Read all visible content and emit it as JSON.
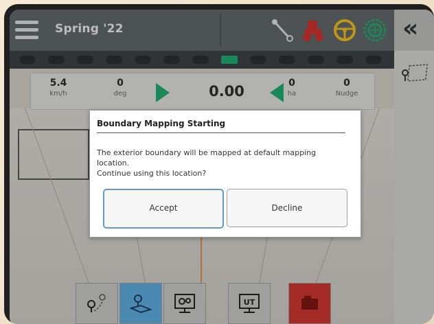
{
  "header": {
    "title": "Spring '22",
    "icons": [
      "menu-icon",
      "implement-hitch-icon",
      "tractor-icon",
      "steering-wheel-icon",
      "gps-status-icon"
    ]
  },
  "lightbar": {
    "segments": 13,
    "active_index": 7,
    "active_color": "#1ea66e"
  },
  "right_panel": {
    "collapse_glyph": "«",
    "icons": [
      "collapse-icon",
      "boundary-map-icon"
    ]
  },
  "info": {
    "speed": {
      "value": "5.4",
      "unit": "km/h"
    },
    "heading": {
      "value": "0",
      "unit": "deg"
    },
    "guidance": {
      "value": "0.00"
    },
    "area": {
      "value": "0",
      "unit": "ha"
    },
    "nudge": {
      "value": "0",
      "unit": "Nudge"
    }
  },
  "dialog": {
    "title": "Boundary Mapping Starting",
    "message_line1": "The exterior boundary will be mapped at default mapping",
    "message_line2": "location.",
    "message_line3": "Continue using this location?",
    "accept_label": "Accept",
    "decline_label": "Decline"
  },
  "toolbar": {
    "items": [
      "pin-route-icon",
      "boundary-map-icon",
      "machine-settings-icon",
      "ut-icon",
      "implement-icon"
    ]
  },
  "colors": {
    "accent_blue": "#5aa8da",
    "danger_red": "#c9352f",
    "green_arrow": "#1ea66e"
  }
}
